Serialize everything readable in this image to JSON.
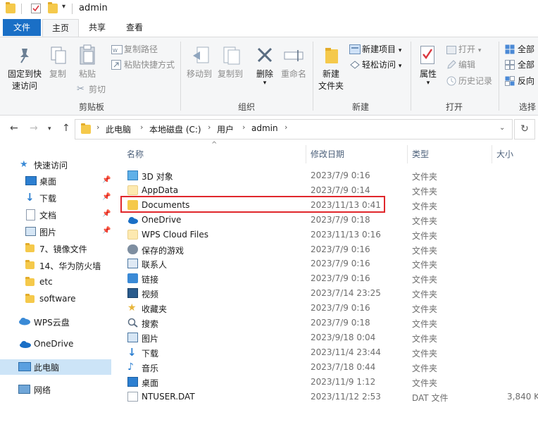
{
  "window": {
    "title": "admin"
  },
  "tabs": {
    "file": "文件",
    "home": "主页",
    "share": "共享",
    "view": "查看"
  },
  "ribbon": {
    "clipboard": {
      "group": "剪贴板",
      "pin_line1": "固定到快",
      "pin_line2": "速访问",
      "copy": "复制",
      "paste": "粘贴",
      "copy_path": "复制路径",
      "paste_shortcut": "粘贴快捷方式",
      "cut": "剪切"
    },
    "organize": {
      "group": "组织",
      "move_to": "移动到",
      "copy_to": "复制到",
      "delete": "删除",
      "rename": "重命名"
    },
    "new": {
      "group": "新建",
      "new_folder_line1": "新建",
      "new_folder_line2": "文件夹",
      "new_item": "新建项目",
      "easy_access": "轻松访问"
    },
    "open": {
      "group": "打开",
      "properties": "属性",
      "open": "打开",
      "edit": "编辑",
      "history": "历史记录"
    },
    "select": {
      "group": "选择",
      "select_all": "全部",
      "select_none": "全部",
      "invert": "反向"
    }
  },
  "address": {
    "crumbs": [
      "此电脑",
      "本地磁盘 (C:)",
      "用户",
      "admin"
    ]
  },
  "navpane": {
    "items": [
      {
        "label": "快速访问",
        "pinned": false
      },
      {
        "label": "桌面",
        "pinned": true
      },
      {
        "label": "下载",
        "pinned": true
      },
      {
        "label": "文档",
        "pinned": true
      },
      {
        "label": "图片",
        "pinned": true
      },
      {
        "label": "7、镜像文件",
        "pinned": false
      },
      {
        "label": "14、华为防火墙",
        "pinned": false
      },
      {
        "label": "etc",
        "pinned": false
      },
      {
        "label": "software",
        "pinned": false
      },
      {
        "label": "WPS云盘",
        "pinned": false
      },
      {
        "label": "OneDrive",
        "pinned": false
      },
      {
        "label": "此电脑",
        "pinned": false
      },
      {
        "label": "网络",
        "pinned": false
      }
    ]
  },
  "columns": {
    "name": "名称",
    "date": "修改日期",
    "type": "类型",
    "size": "大小"
  },
  "files": [
    {
      "name": "3D 对象",
      "date": "2023/7/9 0:16",
      "type": "文件夹",
      "size": "",
      "icon": "3d-objects-icon"
    },
    {
      "name": "AppData",
      "date": "2023/7/9 0:14",
      "type": "文件夹",
      "size": "",
      "icon": "folder-light-icon"
    },
    {
      "name": "Documents",
      "date": "2023/11/13 0:41",
      "type": "文件夹",
      "size": "",
      "icon": "folder-icon"
    },
    {
      "name": "OneDrive",
      "date": "2023/7/9 0:18",
      "type": "文件夹",
      "size": "",
      "icon": "onedrive-icon"
    },
    {
      "name": "WPS Cloud Files",
      "date": "2023/11/13 0:16",
      "type": "文件夹",
      "size": "",
      "icon": "folder-light-icon"
    },
    {
      "name": "保存的游戏",
      "date": "2023/7/9 0:16",
      "type": "文件夹",
      "size": "",
      "icon": "saved-games-icon"
    },
    {
      "name": "联系人",
      "date": "2023/7/9 0:16",
      "type": "文件夹",
      "size": "",
      "icon": "contacts-icon"
    },
    {
      "name": "链接",
      "date": "2023/7/9 0:16",
      "type": "文件夹",
      "size": "",
      "icon": "links-icon"
    },
    {
      "name": "视频",
      "date": "2023/7/14 23:25",
      "type": "文件夹",
      "size": "",
      "icon": "videos-icon"
    },
    {
      "name": "收藏夹",
      "date": "2023/7/9 0:16",
      "type": "文件夹",
      "size": "",
      "icon": "favorites-icon"
    },
    {
      "name": "搜索",
      "date": "2023/7/9 0:18",
      "type": "文件夹",
      "size": "",
      "icon": "searches-icon"
    },
    {
      "name": "图片",
      "date": "2023/9/18 0:04",
      "type": "文件夹",
      "size": "",
      "icon": "pictures-icon"
    },
    {
      "name": "下载",
      "date": "2023/11/4 23:44",
      "type": "文件夹",
      "size": "",
      "icon": "downloads-icon"
    },
    {
      "name": "音乐",
      "date": "2023/7/18 0:44",
      "type": "文件夹",
      "size": "",
      "icon": "music-icon"
    },
    {
      "name": "桌面",
      "date": "2023/11/9 1:12",
      "type": "文件夹",
      "size": "",
      "icon": "desktop-icon"
    },
    {
      "name": "NTUSER.DAT",
      "date": "2023/11/12 2:53",
      "type": "DAT 文件",
      "size": "3,840 K",
      "icon": "file-icon"
    }
  ],
  "colors": {
    "accent": "#1a6fc6",
    "highlight": "#e0272c",
    "selection": "#cce4f7",
    "folder": "#f5c94b"
  }
}
